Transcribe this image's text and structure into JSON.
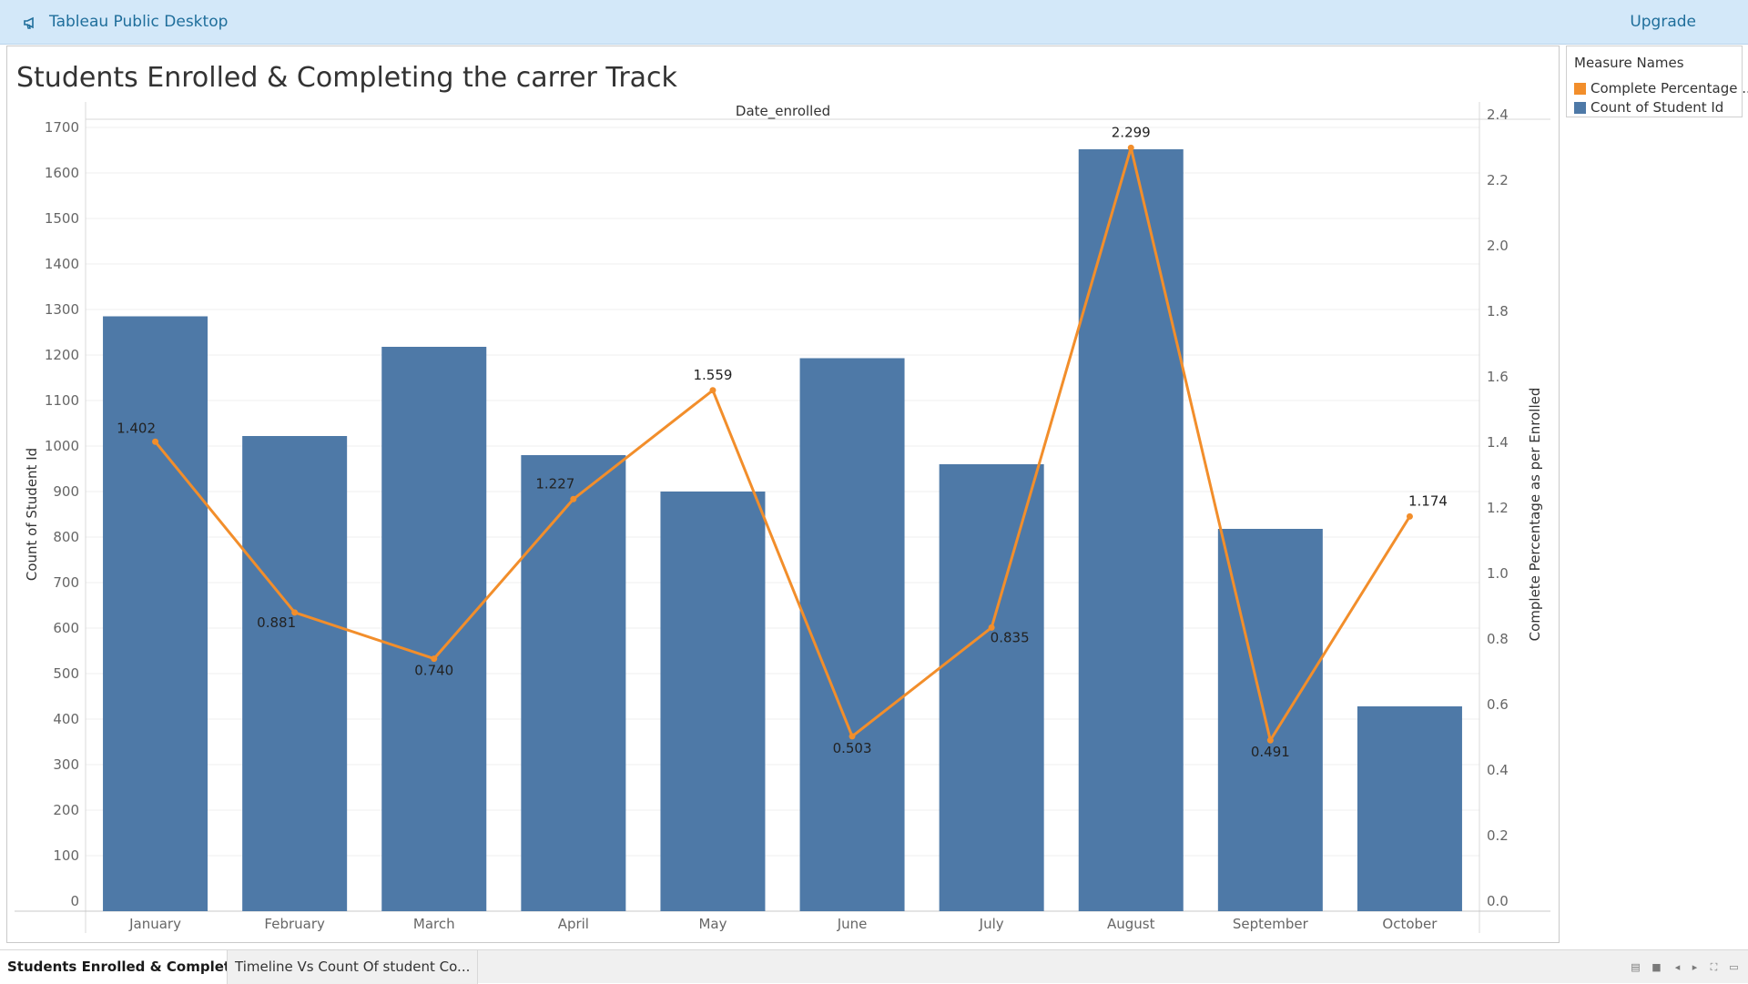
{
  "app": {
    "title": "Tableau Public Desktop",
    "upgrade_label": "Upgrade"
  },
  "sheet": {
    "title": "Students Enrolled & Completing the carrer Track"
  },
  "legend": {
    "title": "Measure Names",
    "items": [
      {
        "label": "Complete Percentage ..",
        "color": "#f28e2b"
      },
      {
        "label": "Count of Student Id",
        "color": "#4e79a7"
      }
    ]
  },
  "tabs": [
    {
      "label": "Students Enrolled & Completin...",
      "active": true
    },
    {
      "label": "Timeline Vs Count Of student Co...",
      "active": false
    }
  ],
  "chart_data": {
    "type": "bar",
    "header": "Date_enrolled",
    "categories": [
      "January",
      "February",
      "March",
      "April",
      "May",
      "June",
      "July",
      "August",
      "September",
      "October"
    ],
    "series": [
      {
        "name": "Count of Student Id",
        "type": "bar",
        "axis": "left",
        "color": "#4e79a7",
        "values": [
          1285,
          1022,
          1218,
          980,
          900,
          1193,
          960,
          1652,
          818,
          428
        ]
      },
      {
        "name": "Complete Percentage as per Enrolled",
        "type": "line",
        "axis": "right",
        "color": "#f28e2b",
        "values": [
          1.402,
          0.881,
          0.74,
          1.227,
          1.559,
          0.503,
          0.835,
          2.299,
          0.491,
          1.174
        ],
        "labels": [
          "1.402",
          "0.881",
          "0.740",
          "1.227",
          "1.559",
          "0.503",
          "0.835",
          "2.299",
          "0.491",
          "1.174"
        ]
      }
    ],
    "ylabel": "Count of Student Id",
    "y2label": "Complete Percentage as per Enrolled",
    "yticks": [
      "0",
      "100",
      "200",
      "300",
      "400",
      "500",
      "600",
      "700",
      "800",
      "900",
      "1000",
      "1100",
      "1200",
      "1300",
      "1400",
      "1500",
      "1600",
      "1700"
    ],
    "ylim": [
      0,
      1700
    ],
    "y2ticks": [
      "0.0",
      "0.2",
      "0.4",
      "0.6",
      "0.8",
      "1.0",
      "1.2",
      "1.4",
      "1.6",
      "1.8",
      "2.0",
      "2.2",
      "2.4"
    ],
    "y2lim": [
      0,
      2.4
    ],
    "grid": true
  }
}
